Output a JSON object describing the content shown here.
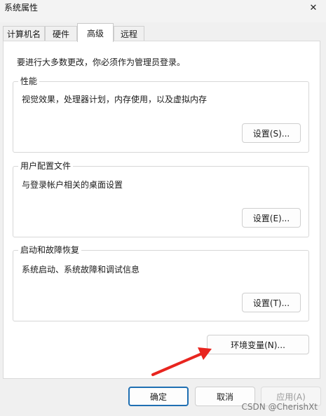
{
  "window": {
    "title": "系统属性",
    "close_glyph": "✕"
  },
  "tabs": [
    {
      "label": "计算机名"
    },
    {
      "label": "硬件"
    },
    {
      "label": "高级",
      "active": true
    },
    {
      "label": "远程"
    }
  ],
  "notice": "要进行大多数更改，你必须作为管理员登录。",
  "groups": {
    "performance": {
      "title": "性能",
      "desc": "视觉效果，处理器计划，内存使用，以及虚拟内存",
      "button": "设置(S)..."
    },
    "profile": {
      "title": "用户配置文件",
      "desc": "与登录帐户相关的桌面设置",
      "button": "设置(E)..."
    },
    "startup": {
      "title": "启动和故障恢复",
      "desc": "系统启动、系统故障和调试信息",
      "button": "设置(T)..."
    }
  },
  "env_button": "环境变量(N)...",
  "footer": {
    "ok": "确定",
    "cancel": "取消",
    "apply": "应用(A)"
  },
  "watermark": "CSDN @CherishXt",
  "colors": {
    "focus_border": "#1f6fb2",
    "arrow": "#e8251f"
  },
  "icons": {
    "close": "close-icon",
    "arrow": "red-arrow-annotation"
  }
}
